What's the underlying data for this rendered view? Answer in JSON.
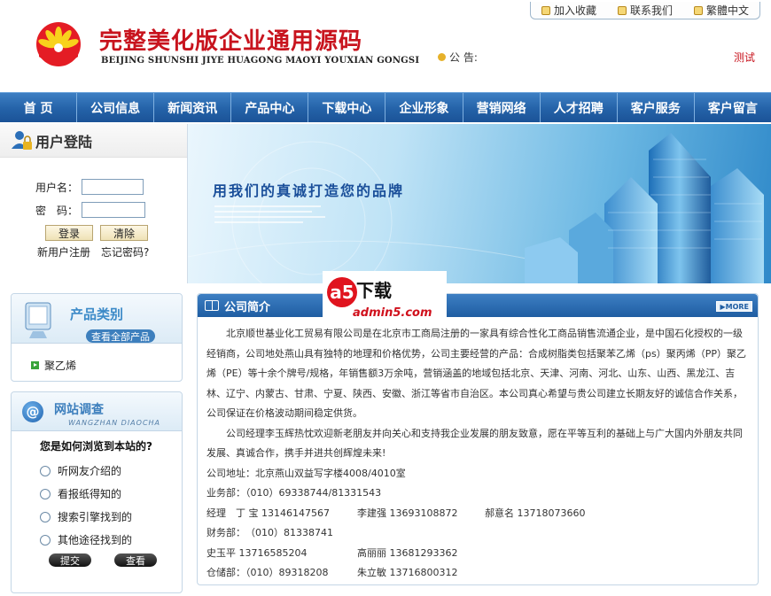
{
  "header": {
    "title": "完整美化版企业通用源码",
    "subtitle": "BEIJING SHUNSHI JIYE HUAGONG MAOYI YOUXIAN GONGSI",
    "toplinks": [
      "加入收藏",
      "联系我们",
      "繁體中文"
    ],
    "notice_label": "公 告:",
    "notice_text": "测试"
  },
  "nav": {
    "items": [
      "首 页",
      "公司信息",
      "新闻资讯",
      "产品中心",
      "下载中心",
      "企业形象",
      "营销网络",
      "人才招聘",
      "客户服务",
      "客户留言"
    ]
  },
  "login": {
    "title": "用户登陆",
    "username_label": "用户名：",
    "password_label": "密　码：",
    "login_button": "登录",
    "clear_button": "清除",
    "register_link": "新用户注册",
    "forgot_link": "忘记密码?"
  },
  "banner": {
    "slogan": "用我们的真诚打造您的品牌"
  },
  "product_category": {
    "title": "产品类别",
    "view_all": "查看全部产品",
    "items": [
      "聚乙烯"
    ]
  },
  "survey": {
    "title": "网站调查",
    "pinyin": "WANGZHAN DIAOCHA",
    "question": "您是如何浏览到本站的?",
    "options": [
      "听网友介绍的",
      "看报纸得知的",
      "搜索引擎找到的",
      "其他途径找到的"
    ],
    "submit_button": "提交",
    "view_button": "查看"
  },
  "intro": {
    "title": "公司简介",
    "more": "MORE",
    "paragraph1": "北京顺世基业化工贸易有限公司是在北京市工商局注册的一家具有综合性化工商品销售流通企业，是中国石化授权的一级经销商，公司地处燕山具有独特的地理和价格优势，公司主要经营的产品：合成树脂类包括聚苯乙烯（ps）聚丙烯（PP）聚乙烯（PE）等十余个牌号/规格，年销售额3万余吨，营销涵盖的地域包括北京、天津、河南、河北、山东、山西、黑龙江、吉林、辽宁、内蒙古、甘肃、宁夏、陕西、安徽、浙江等省市自治区。本公司真心希望与贵公司建立长期友好的诚信合作关系，公司保证在价格波动期间稳定供货。",
    "paragraph2": "公司经理李玉辉热忱欢迎新老朋友并向关心和支持我企业发展的朋友致意，愿在平等互利的基础上与广大国内外朋友共同发展、真诚合作，携手并进共创辉煌未来!",
    "address": "公司地址：北京燕山双益写字楼4008/4010室",
    "business": "业务部：（010）69338744/81331543",
    "managers": [
      {
        "name": "经理　丁 宝",
        "phone": "13146147567"
      },
      {
        "name": "李建强",
        "phone": "13693108872"
      },
      {
        "name": "郝意名",
        "phone": "13718073660"
      }
    ],
    "finance": "财务部：　（010）81338741",
    "staff": [
      {
        "name": "史玉平",
        "phone": "13716585204"
      },
      {
        "name": "高丽丽",
        "phone": "13681293362"
      }
    ],
    "warehouse": "仓储部：（010）89318208",
    "warehouse_staff": {
      "name": "朱立敏",
      "phone": "13716800312"
    }
  },
  "watermark": {
    "text": "下载",
    "domain": "admin5.com"
  }
}
